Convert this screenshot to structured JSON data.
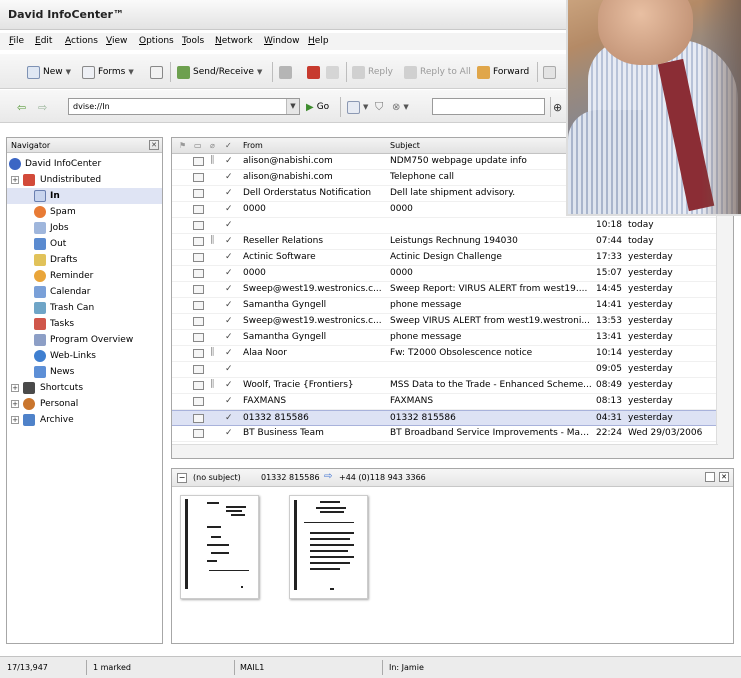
{
  "window": {
    "title": "David InfoCenter™"
  },
  "menu": [
    "File",
    "Edit",
    "Actions",
    "View",
    "Options",
    "Tools",
    "Network",
    "Window",
    "Help"
  ],
  "toolbar": {
    "new": "New",
    "forms": "Forms",
    "send_receive": "Send/Receive",
    "reply": "Reply",
    "reply_all": "Reply to All",
    "forward": "Forward"
  },
  "addressbar": {
    "value": "dvise://In",
    "go": "Go"
  },
  "navigator": {
    "title": "Navigator",
    "items": [
      {
        "label": "David InfoCenter"
      },
      {
        "label": "Undistributed"
      },
      {
        "label": "In"
      },
      {
        "label": "Spam"
      },
      {
        "label": "Jobs"
      },
      {
        "label": "Out"
      },
      {
        "label": "Drafts"
      },
      {
        "label": "Reminder"
      },
      {
        "label": "Calendar"
      },
      {
        "label": "Trash Can"
      },
      {
        "label": "Tasks"
      },
      {
        "label": "Program Overview"
      },
      {
        "label": "Web-Links"
      },
      {
        "label": "News"
      },
      {
        "label": "Shortcuts"
      },
      {
        "label": "Personal"
      },
      {
        "label": "Archive"
      }
    ]
  },
  "list": {
    "columns": {
      "from": "From",
      "subject": "Subject"
    },
    "rows": [
      {
        "from": "alison@nabishi.com",
        "subject": "NDM750 webpage update info",
        "time": "",
        "day": ""
      },
      {
        "from": "alison@nabishi.com",
        "subject": "Telephone call",
        "time": "",
        "day": ""
      },
      {
        "from": "Dell Orderstatus Notification",
        "subject": "Dell late shipment advisory.",
        "time": "",
        "day": ""
      },
      {
        "from": "0000",
        "subject": "0000",
        "time": "",
        "day": ""
      },
      {
        "from": "",
        "subject": "",
        "time": "10:18",
        "day": "today"
      },
      {
        "from": "Reseller Relations",
        "subject": "Leistungs Rechnung 194030",
        "time": "07:44",
        "day": "today"
      },
      {
        "from": "Actinic Software",
        "subject": "Actinic Design Challenge",
        "time": "17:33",
        "day": "yesterday"
      },
      {
        "from": "0000",
        "subject": "0000",
        "time": "15:07",
        "day": "yesterday"
      },
      {
        "from": "Sweep@west19.westronics.c...",
        "subject": "Sweep Report: VIRUS ALERT from west19....",
        "time": "14:45",
        "day": "yesterday"
      },
      {
        "from": "Samantha Gyngell",
        "subject": "phone message",
        "time": "14:41",
        "day": "yesterday"
      },
      {
        "from": "Sweep@west19.westronics.c...",
        "subject": "Sweep VIRUS ALERT from west19.westroni...",
        "time": "13:53",
        "day": "yesterday"
      },
      {
        "from": "Samantha Gyngell",
        "subject": "phone message",
        "time": "13:41",
        "day": "yesterday"
      },
      {
        "from": "Alaa Noor",
        "subject": "Fw: T2000 Obsolescence notice",
        "time": "10:14",
        "day": "yesterday"
      },
      {
        "from": "",
        "subject": "",
        "time": "09:05",
        "day": "yesterday"
      },
      {
        "from": "Woolf, Tracie {Frontiers}",
        "subject": "MSS Data to the Trade - Enhanced Scheme...",
        "time": "08:49",
        "day": "yesterday"
      },
      {
        "from": "FAXMANS",
        "subject": "FAXMANS",
        "time": "08:13",
        "day": "yesterday"
      },
      {
        "from": "01332 815586",
        "subject": "01332 815586",
        "time": "04:31",
        "day": "yesterday"
      },
      {
        "from": "BT Business Team",
        "subject": "BT Broadband Service Improvements - Marc...",
        "time": "22:24",
        "day": "Wed 29/03/2006"
      }
    ]
  },
  "preview": {
    "subject": "(no subject)",
    "from": "01332 815586",
    "arrow": "⇨",
    "to": "+44 (0)118 943 3366"
  },
  "status": {
    "count": "17/13,947",
    "marked": "1 marked",
    "server": "MAIL1",
    "location": "In: Jamie"
  }
}
